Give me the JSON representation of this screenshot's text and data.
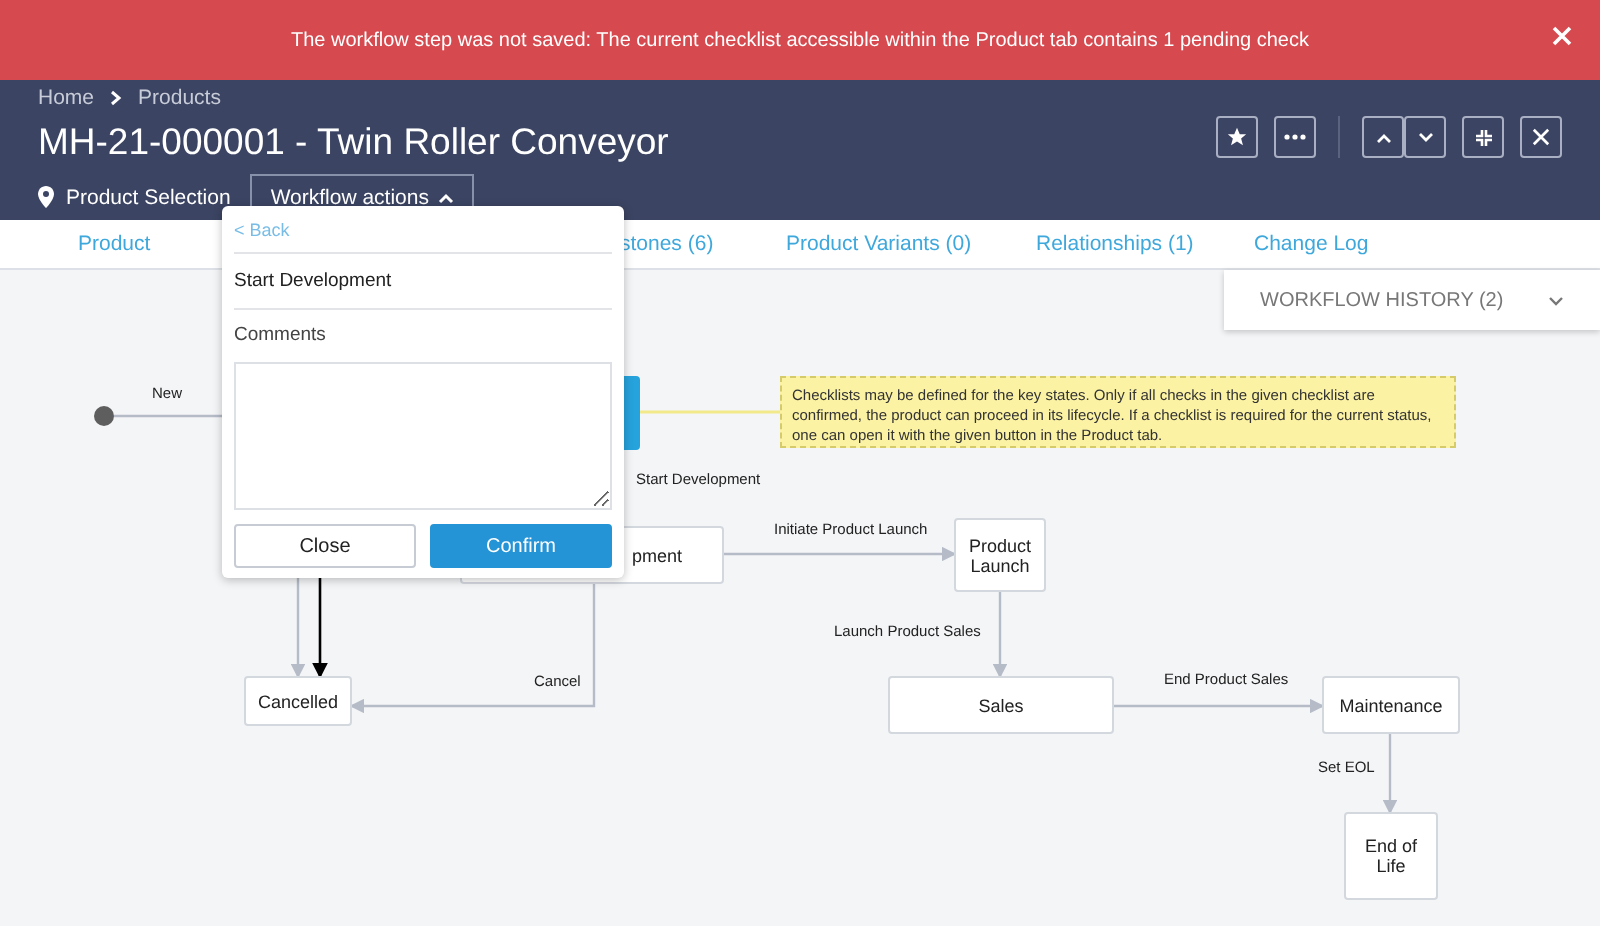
{
  "banner": {
    "message": "The workflow step was not saved: The current checklist accessible within the Product tab contains 1 pending check"
  },
  "breadcrumb": [
    "Home",
    "Products"
  ],
  "title": "MH-21-000001 - Twin Roller Conveyor",
  "status": "Product Selection",
  "workflow_button": {
    "label": "Workflow actions",
    "expanded": true
  },
  "tabs": [
    {
      "label": "Product"
    },
    {
      "label": "stones (6)"
    },
    {
      "label": "Product Variants (0)"
    },
    {
      "label": "Relationships (1)"
    },
    {
      "label": "Change Log"
    }
  ],
  "workflow_history": {
    "label": "WORKFLOW HISTORY (2)"
  },
  "popup": {
    "back": "< Back",
    "action": "Start Development",
    "comments_label": "Comments",
    "buttons": [
      {
        "label": "Close",
        "kind": "secondary"
      },
      {
        "label": "Confirm",
        "kind": "primary"
      }
    ]
  },
  "diagram": {
    "nodes": [
      {
        "kind": "start"
      },
      {
        "kind": "active"
      },
      {
        "kind": "state",
        "label": "pment"
      },
      {
        "kind": "state",
        "label": "Product Launch"
      },
      {
        "kind": "state",
        "label": "Sales"
      },
      {
        "kind": "state",
        "label": "Maintenance"
      },
      {
        "kind": "state",
        "label": "End of Life"
      },
      {
        "kind": "state",
        "label": "Cancelled"
      }
    ],
    "transitions": [
      "New",
      "Start Development",
      "Initiate Product Launch",
      "Launch Product Sales",
      "End Product Sales",
      "Set EOL",
      "Cancel"
    ],
    "note": "Checklists may be defined for the key states. Only if all checks in the given checklist are confirmed, the product can proceed in its lifecycle. If a checklist is required for the current status, one can open it with the given button in the Product tab."
  }
}
